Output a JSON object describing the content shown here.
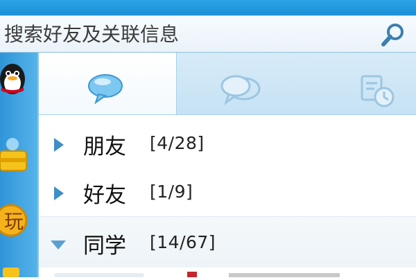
{
  "search": {
    "placeholder": "搜索好友及关联信息",
    "icon": "search-icon"
  },
  "rail": {
    "apps": [
      {
        "icon": "qq-penguin-icon"
      },
      {
        "icon": "qzone-icon"
      },
      {
        "icon": "game-icon"
      },
      {
        "icon": "app-icon"
      }
    ]
  },
  "tabs": [
    {
      "icon": "chat-bubble-icon",
      "active": true
    },
    {
      "icon": "group-chat-icon",
      "active": false
    },
    {
      "icon": "recent-contacts-icon",
      "active": false
    }
  ],
  "groups": [
    {
      "name": "朋友",
      "count": "[4/28]",
      "expanded": false
    },
    {
      "name": "好友",
      "count": "[1/9]",
      "expanded": false
    },
    {
      "name": "同学",
      "count": "[14/67]",
      "expanded": true
    }
  ],
  "colors": {
    "accent": "#1c8fd6",
    "arrow": "#3e8fc6",
    "tab_bg": "#c6e2f4"
  }
}
